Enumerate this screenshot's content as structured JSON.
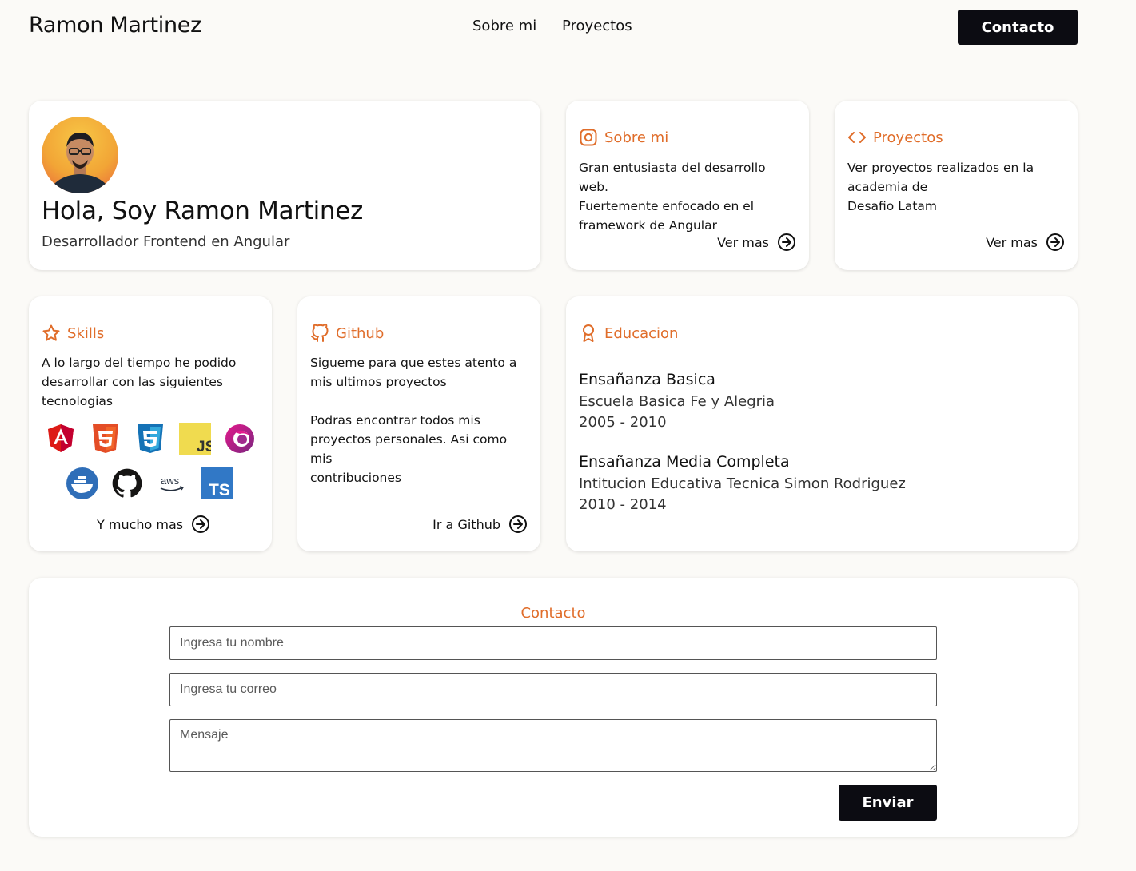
{
  "header": {
    "brand": "Ramon Martinez",
    "nav": [
      "Sobre mi",
      "Proyectos"
    ],
    "contact_label": "Contacto"
  },
  "hero": {
    "title": "Hola, Soy Ramon Martinez",
    "subtitle": "Desarrollador Frontend en Angular"
  },
  "about": {
    "title": "Sobre mi",
    "icon": "instagram-icon",
    "lines": [
      "Gran entusiasta del desarrollo web.",
      "Fuertemente enfocado en el",
      "framework de Angular"
    ],
    "link": "Ver mas"
  },
  "projects": {
    "title": "Proyectos",
    "icon": "code-icon",
    "lines": [
      "Ver proyectos realizados en la",
      "academia de",
      "Desafio Latam"
    ],
    "link": "Ver mas"
  },
  "skills": {
    "title": "Skills",
    "icon": "star-icon",
    "lines": [
      "A lo largo del tiempo he podido",
      "desarrollar con las siguientes",
      "tecnologias"
    ],
    "tech_row1": [
      "angular-icon",
      "html5-icon",
      "css3-icon",
      "javascript-icon",
      "rxjs-icon"
    ],
    "tech_row2": [
      "docker-icon",
      "github-icon",
      "aws-icon",
      "typescript-icon"
    ],
    "link": "Y mucho mas"
  },
  "github": {
    "title": "Github",
    "icon": "github-icon",
    "lines": [
      "Sigueme para que estes atento a",
      "mis ultimos proyectos",
      "",
      "Podras encontrar todos mis",
      "proyectos personales. Asi como mis",
      "contribuciones"
    ],
    "link": "Ir a Github"
  },
  "education": {
    "title": "Educacion",
    "icon": "award-icon",
    "items": [
      {
        "title": "Ensañanza Basica",
        "school": "Escuela Basica Fe y Alegria",
        "years": "2005 - 2010"
      },
      {
        "title": "Ensañanza Media Completa",
        "school": "Intitucion Educativa Tecnica Simon Rodriguez",
        "years": "2010 - 2014"
      }
    ]
  },
  "contact": {
    "heading": "Contacto",
    "name_placeholder": "Ingresa tu nombre",
    "email_placeholder": "Ingresa tu correo",
    "message_placeholder": "Mensaje",
    "submit": "Enviar"
  },
  "colors": {
    "accent": "#e06d2a",
    "button": "#0c0c12",
    "background": "#fbfaf7"
  }
}
